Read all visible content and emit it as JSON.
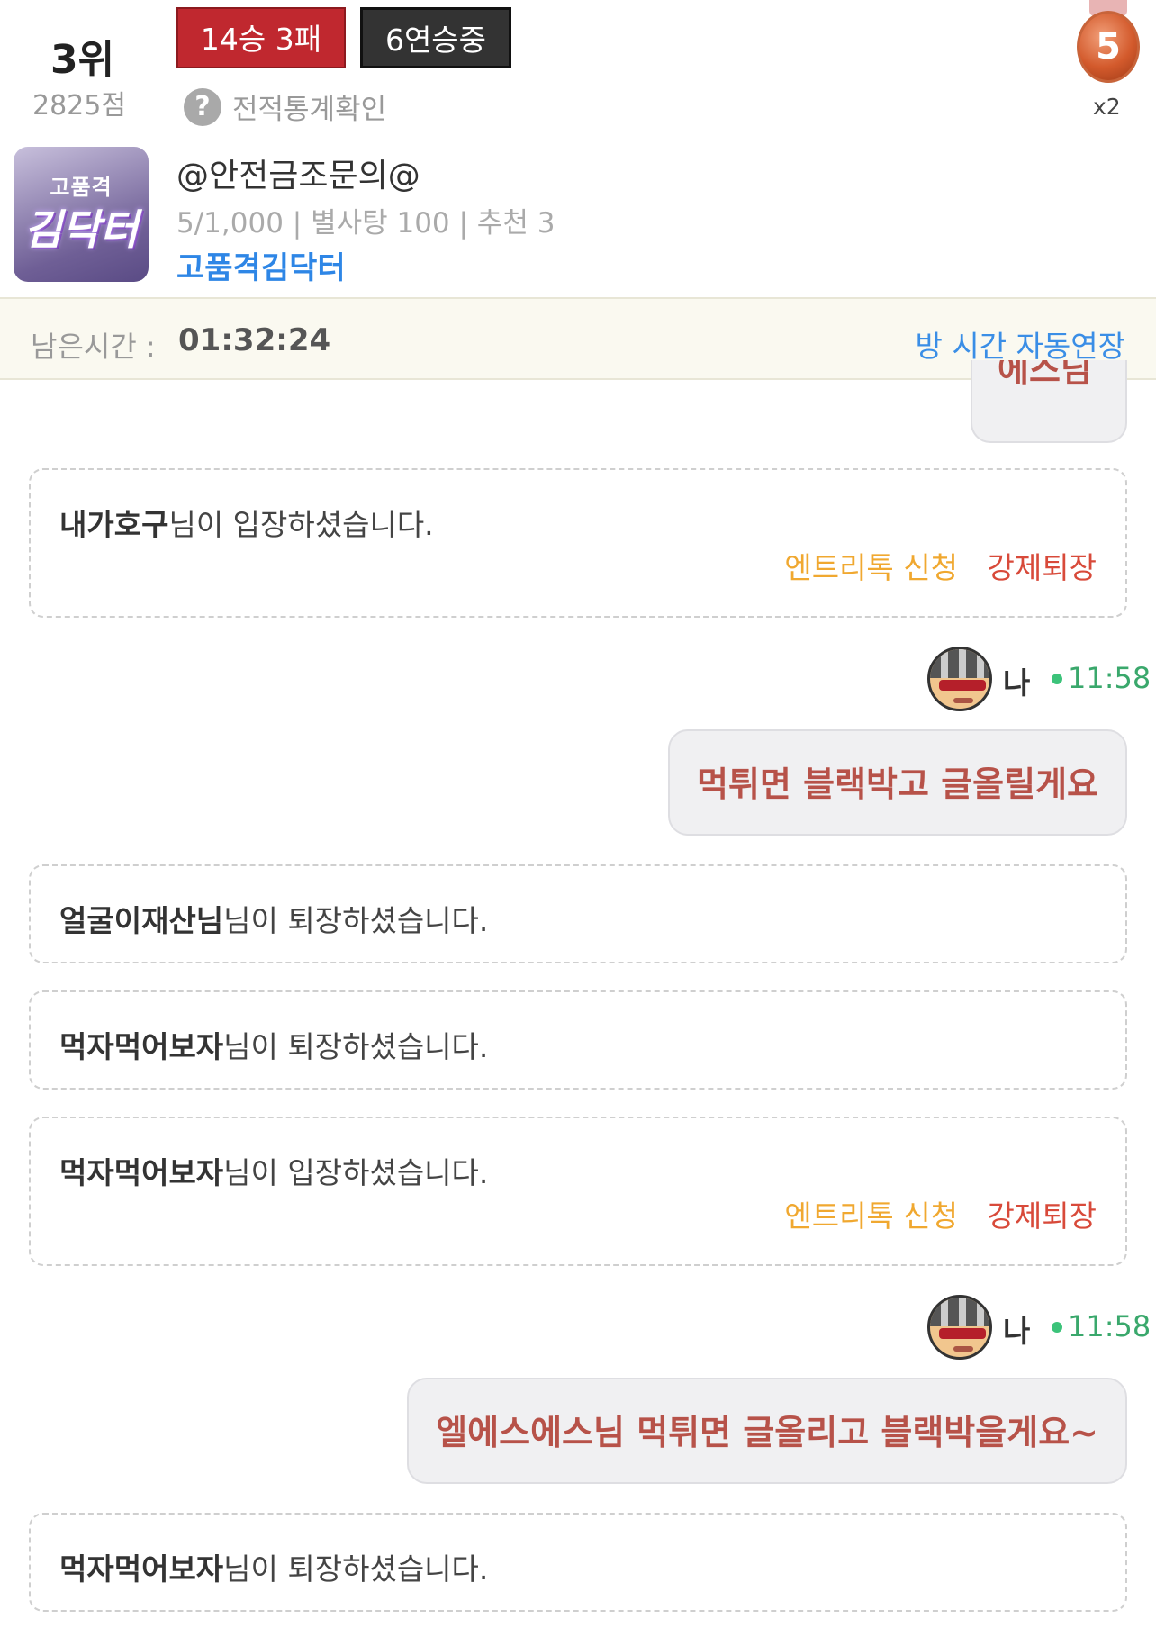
{
  "header": {
    "rank": "3위",
    "score": "2825점",
    "record": "14승 3패",
    "streak": "6연승중",
    "stats_link": "전적통계확인",
    "help_icon": "?",
    "medal": {
      "number": "5",
      "count": "x2"
    }
  },
  "room": {
    "thumbnail": {
      "top": "고품격",
      "main": "김닥터"
    },
    "title": "@안전금조문의@",
    "meta": "5/1,000 | 별사탕 100 | 추천 3",
    "host": "고품격김닥터"
  },
  "timer": {
    "label": "남은시간 :",
    "value": "01:32:24",
    "extend_label": "방 시간 자동연장"
  },
  "chat": {
    "partial_bubble": "에스님",
    "notice_suffix_enter": "님이 입장하셨습니다.",
    "notice_suffix_leave": "님이 퇴장하셨습니다.",
    "entry_ticket_label": "엔트리톡 신청",
    "kick_label": "강제퇴장",
    "me_label": "나",
    "messages": [
      {
        "name": "내가호구"
      },
      {
        "time": "11:58",
        "text": "먹튀면 블랙박고 글올릴게요"
      },
      {
        "name": "얼굴이재산님"
      },
      {
        "name": "먹자먹어보자"
      },
      {
        "name": "먹자먹어보자"
      },
      {
        "time": "11:58",
        "text": "엘에스에스님 먹튀면 글올리고 블랙박을게요~"
      },
      {
        "name": "먹자먹어보자"
      }
    ]
  }
}
